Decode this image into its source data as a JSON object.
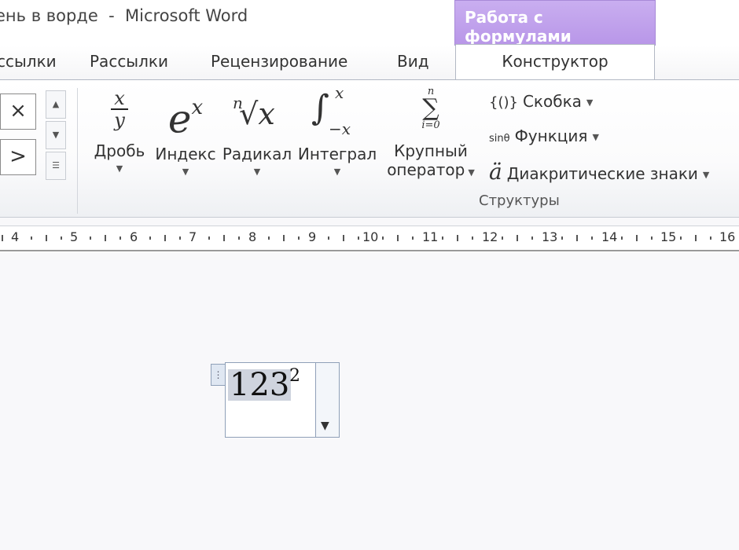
{
  "window": {
    "title": "ень в ворде  -  Microsoft Word"
  },
  "context_tab": {
    "title": "Работа с формулами"
  },
  "tabs": [
    {
      "label": "ссылки"
    },
    {
      "label": "Рассылки"
    },
    {
      "label": "Рецензирование"
    },
    {
      "label": "Вид"
    },
    {
      "label": "Конструктор",
      "active": true
    }
  ],
  "symbols": [
    "×",
    ">"
  ],
  "structures": {
    "group_label": "Структуры",
    "big_buttons": [
      {
        "id": "fraction",
        "label": "Дробь",
        "icon": "fraction-icon",
        "icon_top": "x",
        "icon_bottom": "y"
      },
      {
        "id": "index",
        "label": "Индекс",
        "icon": "script-icon",
        "icon_base": "e",
        "icon_sup": "x"
      },
      {
        "id": "radical",
        "label": "Радикал",
        "icon": "radical-icon",
        "icon_index": "n",
        "icon_text": "√x"
      },
      {
        "id": "integral",
        "label": "Интеграл",
        "icon": "integral-icon",
        "icon_sym": "∫",
        "icon_upper": "x",
        "icon_lower": "−x"
      },
      {
        "id": "large-operator",
        "label_line1": "Крупный",
        "label_line2": "оператор",
        "icon": "sum-icon",
        "icon_upper": "n",
        "icon_sym": "∑",
        "icon_lower": "i=0"
      }
    ],
    "small_buttons": [
      {
        "id": "bracket",
        "icon_text": "{()}",
        "label": "Скобка"
      },
      {
        "id": "function",
        "icon_text": "sinθ",
        "label": "Функция"
      },
      {
        "id": "accent",
        "icon_text": "ä",
        "label": "Диакритические знаки"
      }
    ]
  },
  "ruler": {
    "numbers": [
      "4",
      "5",
      "6",
      "7",
      "8",
      "9",
      "10",
      "11",
      "12",
      "13",
      "14",
      "15",
      "16"
    ]
  },
  "equation": {
    "base": "123",
    "exponent": "2"
  }
}
